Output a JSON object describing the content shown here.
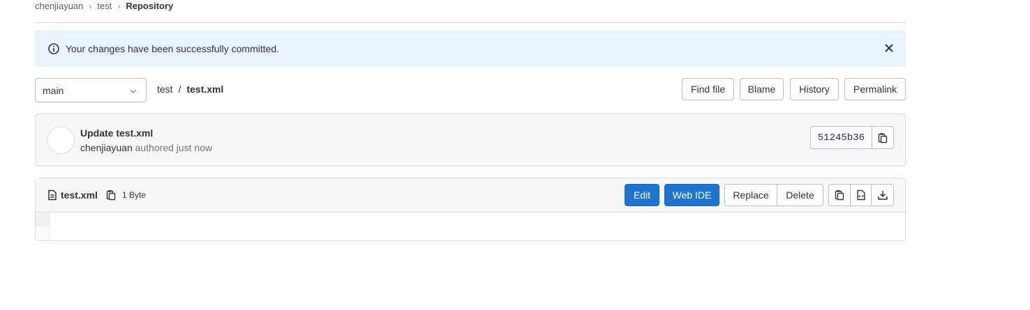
{
  "breadcrumb": {
    "items": [
      "chenjiayuan",
      "test",
      "Repository"
    ],
    "separator": "›"
  },
  "alert": {
    "message": "Your changes have been successfully committed.",
    "icon": "info-icon",
    "close_icon": "close-icon"
  },
  "nav": {
    "branch": "main",
    "path_dir": "test",
    "path_sep": "/",
    "path_file": "test.xml",
    "buttons": {
      "find_file": "Find file",
      "blame": "Blame",
      "history": "History",
      "permalink": "Permalink"
    }
  },
  "commit": {
    "title": "Update test.xml",
    "author": "chenjiayuan",
    "authored_text": "authored just now",
    "sha": "51245b36"
  },
  "file": {
    "name": "test.xml",
    "size": "1 Byte",
    "buttons": {
      "edit": "Edit",
      "web_ide": "Web IDE",
      "replace": "Replace",
      "delete": "Delete"
    }
  },
  "colors": {
    "primary": "#1f75cb",
    "alert_bg": "#e9f3fc"
  }
}
